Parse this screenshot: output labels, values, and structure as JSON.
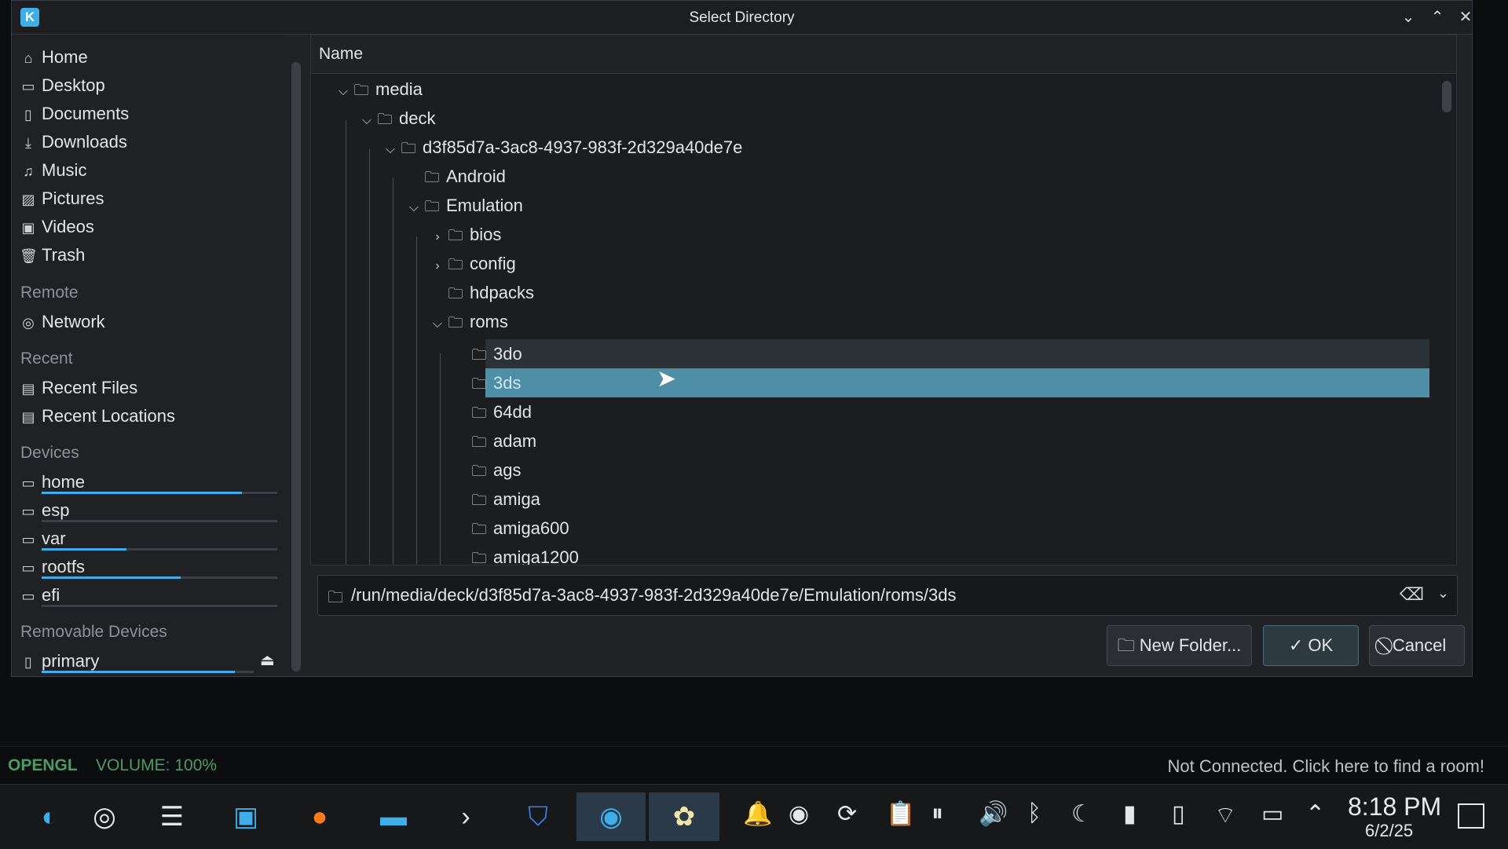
{
  "dialog": {
    "title": "Select Directory",
    "app_icon": "kde-icon",
    "controls": [
      "minimize",
      "maximize",
      "close"
    ]
  },
  "places": {
    "items": [
      {
        "label": "Home",
        "icon": "home-icon"
      },
      {
        "label": "Desktop",
        "icon": "desktop-icon"
      },
      {
        "label": "Documents",
        "icon": "documents-icon"
      },
      {
        "label": "Downloads",
        "icon": "downloads-icon"
      },
      {
        "label": "Music",
        "icon": "music-icon"
      },
      {
        "label": "Pictures",
        "icon": "pictures-icon"
      },
      {
        "label": "Videos",
        "icon": "videos-icon"
      },
      {
        "label": "Trash",
        "icon": "trash-icon"
      }
    ],
    "remote_header": "Remote",
    "remote": [
      {
        "label": "Network",
        "icon": "network-icon"
      }
    ],
    "recent_header": "Recent",
    "recent": [
      {
        "label": "Recent Files",
        "icon": "recent-files-icon"
      },
      {
        "label": "Recent Locations",
        "icon": "recent-locations-icon"
      }
    ],
    "devices_header": "Devices",
    "devices": [
      {
        "label": "home",
        "usage": 0.85
      },
      {
        "label": "esp",
        "usage": 0.0
      },
      {
        "label": "var",
        "usage": 0.36
      },
      {
        "label": "rootfs",
        "usage": 0.59
      },
      {
        "label": "efi",
        "usage": 0.0
      }
    ],
    "removable_header": "Removable Devices",
    "removable": [
      {
        "label": "primary",
        "usage": 0.91
      }
    ]
  },
  "tree": {
    "column_name": "Name",
    "rows": [
      "media",
      "deck",
      "d3f85d7a-3ac8-4937-983f-2d329a40de7e",
      "Android",
      "Emulation",
      "bios",
      "config",
      "hdpacks",
      "roms",
      "3do",
      "3ds",
      "64dd",
      "adam",
      "ags",
      "amiga",
      "amiga600",
      "amiga1200"
    ],
    "selected": "3ds"
  },
  "path": {
    "value": "/run/media/deck/d3f85d7a-3ac8-4937-983f-2d329a40de7e/Emulation/roms/3ds"
  },
  "buttons": {
    "new_folder": "New Folder...",
    "ok": "OK",
    "cancel": "Cancel"
  },
  "status": {
    "renderer": "OPENGL",
    "volume": "VOLUME: 100%",
    "netplay": "Not Connected. Click here to find a room!"
  },
  "taskbar": {
    "time": "8:18 PM",
    "date": "6/2/25"
  }
}
